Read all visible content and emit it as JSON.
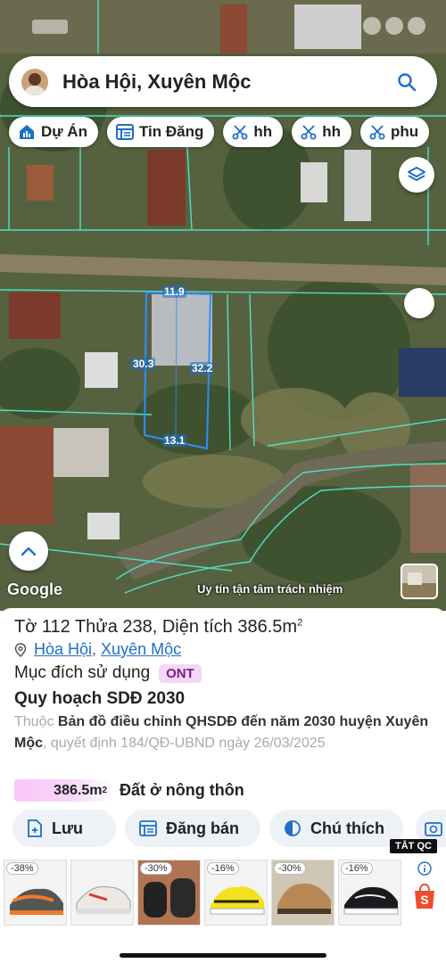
{
  "search": {
    "text": "Hòa Hội, Xuyên Mộc"
  },
  "chips": [
    {
      "label": "Dự Án",
      "icon": "home-chart-icon"
    },
    {
      "label": "Tin Đăng",
      "icon": "list-icon"
    },
    {
      "label": "hh",
      "icon": "scissors-icon"
    },
    {
      "label": "hh",
      "icon": "scissors-icon"
    },
    {
      "label": "phu",
      "icon": "scissors-icon"
    }
  ],
  "map": {
    "plot_dims": {
      "top": "11.9",
      "left": "30.3",
      "right": "32.2",
      "bottom": "13.1"
    },
    "google": "Google",
    "watermark": "Uy tín tận tâm trách nhiệm"
  },
  "parcel": {
    "title_prefix": "Tờ 112 Thửa 238, Diện tích 386.5m",
    "title_sup": "2",
    "commune": "Hòa Hội",
    "separator": ", ",
    "district": "Xuyên Mộc",
    "purpose_label": "Mục đích sử dụng",
    "purpose_code": "ONT",
    "plan_title": "Quy hoạch SDĐ 2030",
    "plan_desc_1": "Thuộc ",
    "plan_desc_2": "Bản đồ điều chỉnh QHSDĐ đến năm 2030 huyện Xuyên Mộc",
    "plan_desc_3": ", quyết định 184/QĐ-UBND ngày 26/03/2025",
    "area_value": "386.5m",
    "area_sup": "2",
    "area_label": "Đất ở nông thôn"
  },
  "actions": [
    {
      "label": "Lưu",
      "icon": "save-add-icon"
    },
    {
      "label": "Đăng bán",
      "icon": "listing-icon"
    },
    {
      "label": "Chú thích",
      "icon": "half-circle-icon"
    }
  ],
  "ads": {
    "label": "TẮT QC",
    "items": [
      {
        "badge": "-38%"
      },
      {
        "badge": ""
      },
      {
        "badge": "-30%"
      },
      {
        "badge": "-16%"
      },
      {
        "badge": "-30%"
      },
      {
        "badge": "-16%"
      }
    ],
    "colors": {
      "accent": "#1f6fc5",
      "shopee": "#ee4d2d"
    }
  }
}
